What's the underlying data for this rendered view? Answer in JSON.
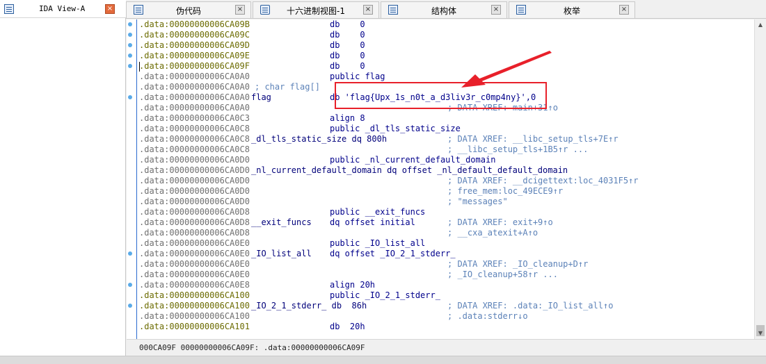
{
  "left_tab": {
    "label": "IDA View-A",
    "close": "×"
  },
  "tabs": [
    {
      "label": "伪代码",
      "close": "×"
    },
    {
      "label": "十六进制视图-1",
      "close": "×"
    },
    {
      "label": "结构体",
      "close": "×"
    },
    {
      "label": "枚举",
      "close": "×"
    }
  ],
  "lines": [
    {
      "addr": ".data:00000000006CA09B",
      "label": "",
      "instr": "db    0",
      "comment": ""
    },
    {
      "addr": ".data:00000000006CA09C",
      "label": "",
      "instr": "db    0",
      "comment": ""
    },
    {
      "addr": ".data:00000000006CA09D",
      "label": "",
      "instr": "db    0",
      "comment": ""
    },
    {
      "addr": ".data:00000000006CA09E",
      "label": "",
      "instr": "db    0",
      "comment": ""
    },
    {
      "addr": ".data:00000000006CA09F",
      "label": "",
      "instr": "db    0",
      "comment": ""
    },
    {
      "addr": ".data:00000000006CA0A0",
      "label": "",
      "instr": "public flag",
      "comment": ""
    },
    {
      "addr": ".data:00000000006CA0A0",
      "label": "",
      "instr": "",
      "comment": "; char flag[]"
    },
    {
      "addr": ".data:00000000006CA0A0",
      "label": "flag",
      "instr": "db 'flag{Upx_1s_n0t_a_d3liv3r_c0mp4ny}',0",
      "comment": ""
    },
    {
      "addr": ".data:00000000006CA0A0",
      "label": "",
      "instr": "",
      "comment": "; DATA XREF: main+31↑o"
    },
    {
      "addr": ".data:00000000006CA0C3",
      "label": "",
      "instr": "align 8",
      "comment": ""
    },
    {
      "addr": ".data:00000000006CA0C8",
      "label": "",
      "instr": "public _dl_tls_static_size",
      "comment": ""
    },
    {
      "addr": ".data:00000000006CA0C8",
      "label": "_dl_tls_static_size dq 800h",
      "instr": "",
      "comment": "; DATA XREF: __libc_setup_tls+7E↑r"
    },
    {
      "addr": ".data:00000000006CA0C8",
      "label": "",
      "instr": "",
      "comment": "; __libc_setup_tls+1B5↑r ..."
    },
    {
      "addr": ".data:00000000006CA0D0",
      "label": "",
      "instr": "public _nl_current_default_domain",
      "comment": ""
    },
    {
      "addr": ".data:00000000006CA0D0",
      "label": "_nl_current_default_domain dq offset _nl_default_default_domain",
      "instr": "",
      "comment": ""
    },
    {
      "addr": ".data:00000000006CA0D0",
      "label": "",
      "instr": "",
      "comment": "; DATA XREF: __dcigettext:loc_4031F5↑r"
    },
    {
      "addr": ".data:00000000006CA0D0",
      "label": "",
      "instr": "",
      "comment": "; free_mem:loc_49ECE9↑r"
    },
    {
      "addr": ".data:00000000006CA0D0",
      "label": "",
      "instr": "",
      "comment": "; \"messages\""
    },
    {
      "addr": ".data:00000000006CA0D8",
      "label": "",
      "instr": "public __exit_funcs",
      "comment": ""
    },
    {
      "addr": ".data:00000000006CA0D8",
      "label": "__exit_funcs",
      "instr": "dq offset initial",
      "comment": "; DATA XREF: exit+9↑o"
    },
    {
      "addr": ".data:00000000006CA0D8",
      "label": "",
      "instr": "",
      "comment": "; __cxa_atexit+A↑o"
    },
    {
      "addr": ".data:00000000006CA0E0",
      "label": "",
      "instr": "public _IO_list_all",
      "comment": ""
    },
    {
      "addr": ".data:00000000006CA0E0",
      "label": "_IO_list_all",
      "instr": "dq offset _IO_2_1_stderr_",
      "comment": ""
    },
    {
      "addr": ".data:00000000006CA0E0",
      "label": "",
      "instr": "",
      "comment": "; DATA XREF: _IO_cleanup+D↑r"
    },
    {
      "addr": ".data:00000000006CA0E0",
      "label": "",
      "instr": "",
      "comment": "; _IO_cleanup+58↑r ..."
    },
    {
      "addr": ".data:00000000006CA0E8",
      "label": "",
      "instr": "align 20h",
      "comment": ""
    },
    {
      "addr": ".data:00000000006CA100",
      "label": "",
      "instr": "public _IO_2_1_stderr_",
      "comment": ""
    },
    {
      "addr": ".data:00000000006CA100",
      "label": "_IO_2_1_stderr_ db  86h",
      "instr": "",
      "comment": "; DATA XREF: .data:_IO_list_all↑o"
    },
    {
      "addr": ".data:00000000006CA100",
      "label": "",
      "instr": "",
      "comment": "; .data:stderr↓o"
    },
    {
      "addr": ".data:00000000006CA101",
      "label": "",
      "instr": "db  20h",
      "comment": ""
    }
  ],
  "status": {
    "text": "000CA09F 00000000006CA09F: .data:00000000006CA09F"
  },
  "colors": {
    "highlight": "#e8202a",
    "address": "#6b6b00",
    "comment": "#5c82b8"
  }
}
